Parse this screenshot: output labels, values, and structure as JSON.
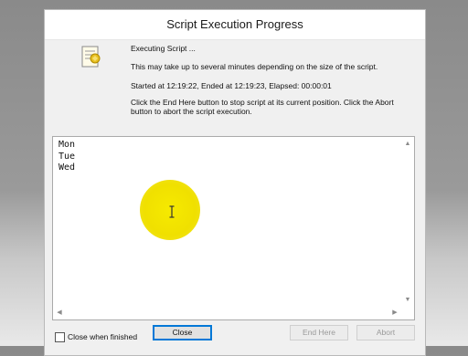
{
  "window": {
    "title": "Script Execution Progress"
  },
  "status": {
    "line1": "Executing Script ...",
    "line2": "This may take up to several minutes depending on the size of the script.",
    "timing": "Started at 12:19:22, Ended at 12:19:23,  Elapsed: 00:00:01",
    "help": "Click the End Here button to stop script at its current position. Click the Abort button to abort the script execution."
  },
  "output": {
    "lines": [
      "Mon",
      "Tue",
      "Wed"
    ]
  },
  "footer": {
    "checkbox_label": "Close when finished",
    "close_label": "Close",
    "end_here_label": "End Here",
    "abort_label": "Abort"
  },
  "colors": {
    "cursor_highlight": "#f0e000"
  }
}
